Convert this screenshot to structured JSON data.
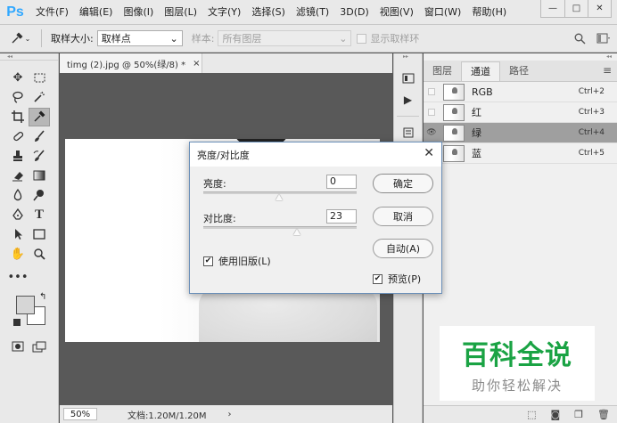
{
  "app": {
    "logo": "Ps",
    "menu": [
      "文件(F)",
      "编辑(E)",
      "图像(I)",
      "图层(L)",
      "文字(Y)",
      "选择(S)",
      "滤镜(T)",
      "3D(D)",
      "视图(V)",
      "窗口(W)",
      "帮助(H)"
    ],
    "window_controls": {
      "minimize": "—",
      "restore": "□",
      "close": "✕"
    }
  },
  "options_bar": {
    "tool_icon": "eyedropper-icon",
    "sample_size_label": "取样大小:",
    "sample_size_value": "取样点",
    "sample_label": "样本:",
    "sample_value": "所有图层",
    "show_ring_label": "显示取样环"
  },
  "document": {
    "tab_title": "timg (2).jpg @ 50%(绿/8) *",
    "tab_close": "×",
    "zoom": "50%",
    "doc_info": "文档:1.20M/1.20M",
    "status_arrow": "›"
  },
  "channels_panel": {
    "tabs": [
      "图层",
      "通道",
      "路径"
    ],
    "active_tab": "通道",
    "channels": [
      {
        "name": "RGB",
        "shortcut": "Ctrl+2",
        "visible": false,
        "selected": false
      },
      {
        "name": "红",
        "shortcut": "Ctrl+3",
        "visible": false,
        "selected": false
      },
      {
        "name": "绿",
        "shortcut": "Ctrl+4",
        "visible": true,
        "selected": true
      },
      {
        "name": "蓝",
        "shortcut": "Ctrl+5",
        "visible": false,
        "selected": false
      }
    ]
  },
  "dialog": {
    "title": "亮度/对比度",
    "brightness_label": "亮度:",
    "brightness_value": "0",
    "contrast_label": "对比度:",
    "contrast_value": "23",
    "ok_label": "确定",
    "cancel_label": "取消",
    "auto_label": "自动(A)",
    "legacy_label": "使用旧版(L)",
    "legacy_checked": true,
    "preview_label": "预览(P)",
    "preview_checked": true,
    "close": "✕"
  },
  "watermark": {
    "title": "百科全说",
    "subtitle": "助你轻松解决"
  }
}
